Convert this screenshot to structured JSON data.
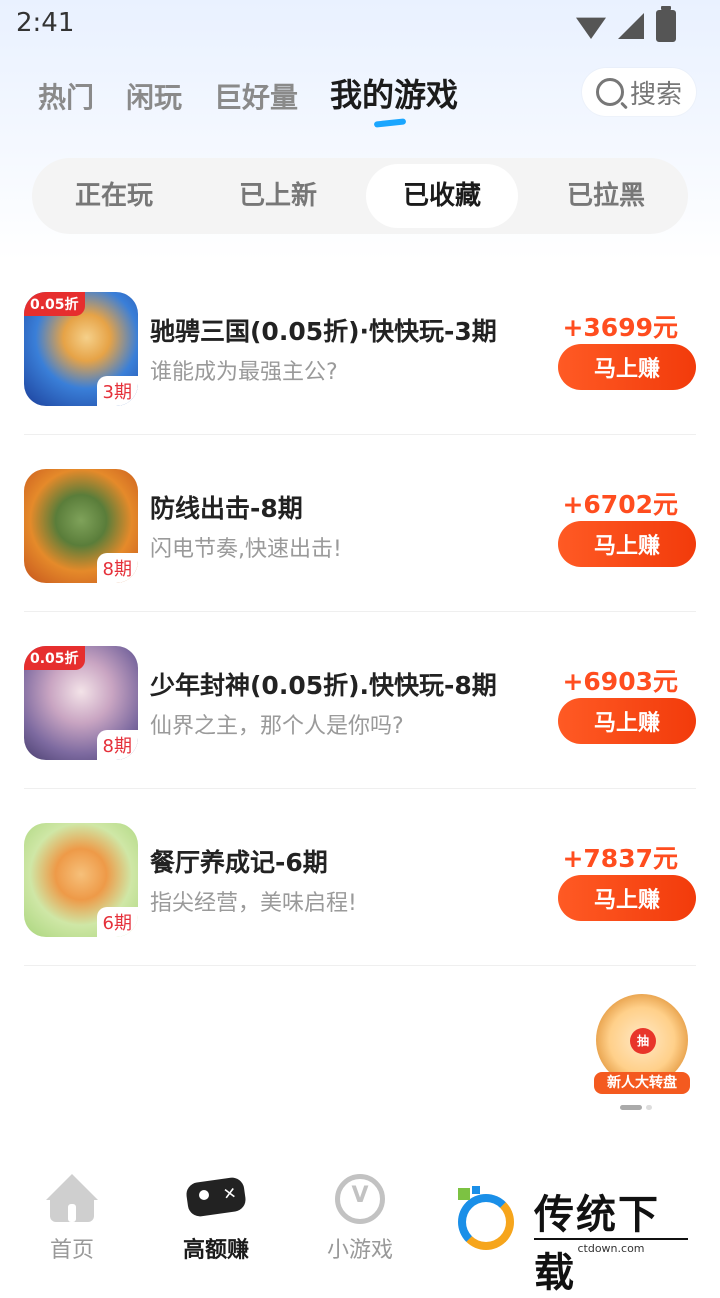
{
  "status_bar": {
    "time": "2:41"
  },
  "nav": {
    "tabs": [
      {
        "label": "热门"
      },
      {
        "label": "闲玩"
      },
      {
        "label": "巨好量"
      },
      {
        "label": "我的游戏"
      }
    ],
    "search_label": "搜索"
  },
  "segments": [
    {
      "label": "正在玩"
    },
    {
      "label": "已上新"
    },
    {
      "label": "已收藏"
    },
    {
      "label": "已拉黑"
    }
  ],
  "games": [
    {
      "name": "驰骋三国(0.05折)·快快玩-3期",
      "desc": "谁能成为最强主公?",
      "reward": "+3699元",
      "button": "马上赚",
      "period": "3期",
      "discount": "0.05折"
    },
    {
      "name": "防线出击-8期",
      "desc": "闪电节奏,快速出击!",
      "reward": "+6702元",
      "button": "马上赚",
      "period": "8期"
    },
    {
      "name": "少年封神(0.05折).快快玩-8期",
      "desc": "仙界之主，那个人是你吗?",
      "reward": "+6903元",
      "button": "马上赚",
      "period": "8期",
      "discount": "0.05折"
    },
    {
      "name": "餐厅养成记-6期",
      "desc": "指尖经营，美味启程!",
      "reward": "+7837元",
      "button": "马上赚",
      "period": "6期"
    }
  ],
  "float_widget": {
    "label": "新人大转盘",
    "center": "抽"
  },
  "bottom_tabs": [
    {
      "label": "首页"
    },
    {
      "label": "高额赚"
    },
    {
      "label": "小游戏"
    }
  ],
  "watermark": {
    "title": "传统下载",
    "url": "ctdown.com"
  },
  "colors": {
    "accent": "#ff4d1f",
    "tab_underline": "#1aa6ff"
  }
}
